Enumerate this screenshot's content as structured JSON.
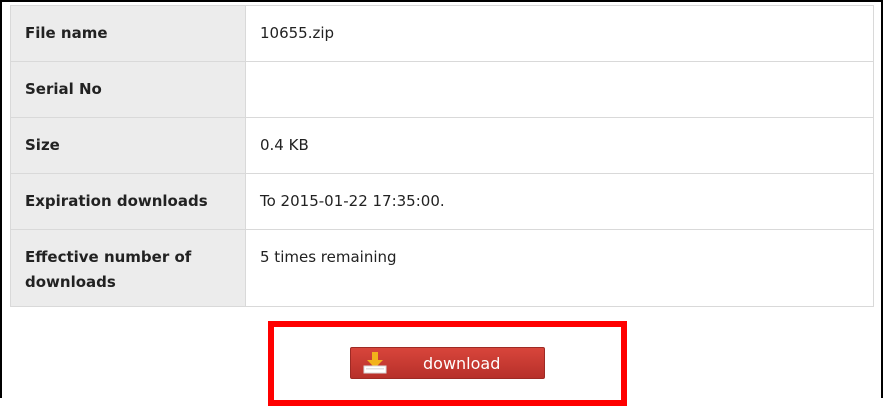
{
  "file_info": {
    "rows": [
      {
        "label": "File name",
        "value": "10655.zip"
      },
      {
        "label": "Serial No",
        "value": ""
      },
      {
        "label": "Size",
        "value": "0.4 KB"
      },
      {
        "label": "Expiration downloads",
        "value": "To 2015-01-22 17:35:00."
      },
      {
        "label": "Effective number of downloads",
        "value": "5 times remaining"
      }
    ]
  },
  "download": {
    "label": "download",
    "icon": "download-tray-icon",
    "button_color": "#c93a31",
    "highlight_color": "#ff0000"
  }
}
